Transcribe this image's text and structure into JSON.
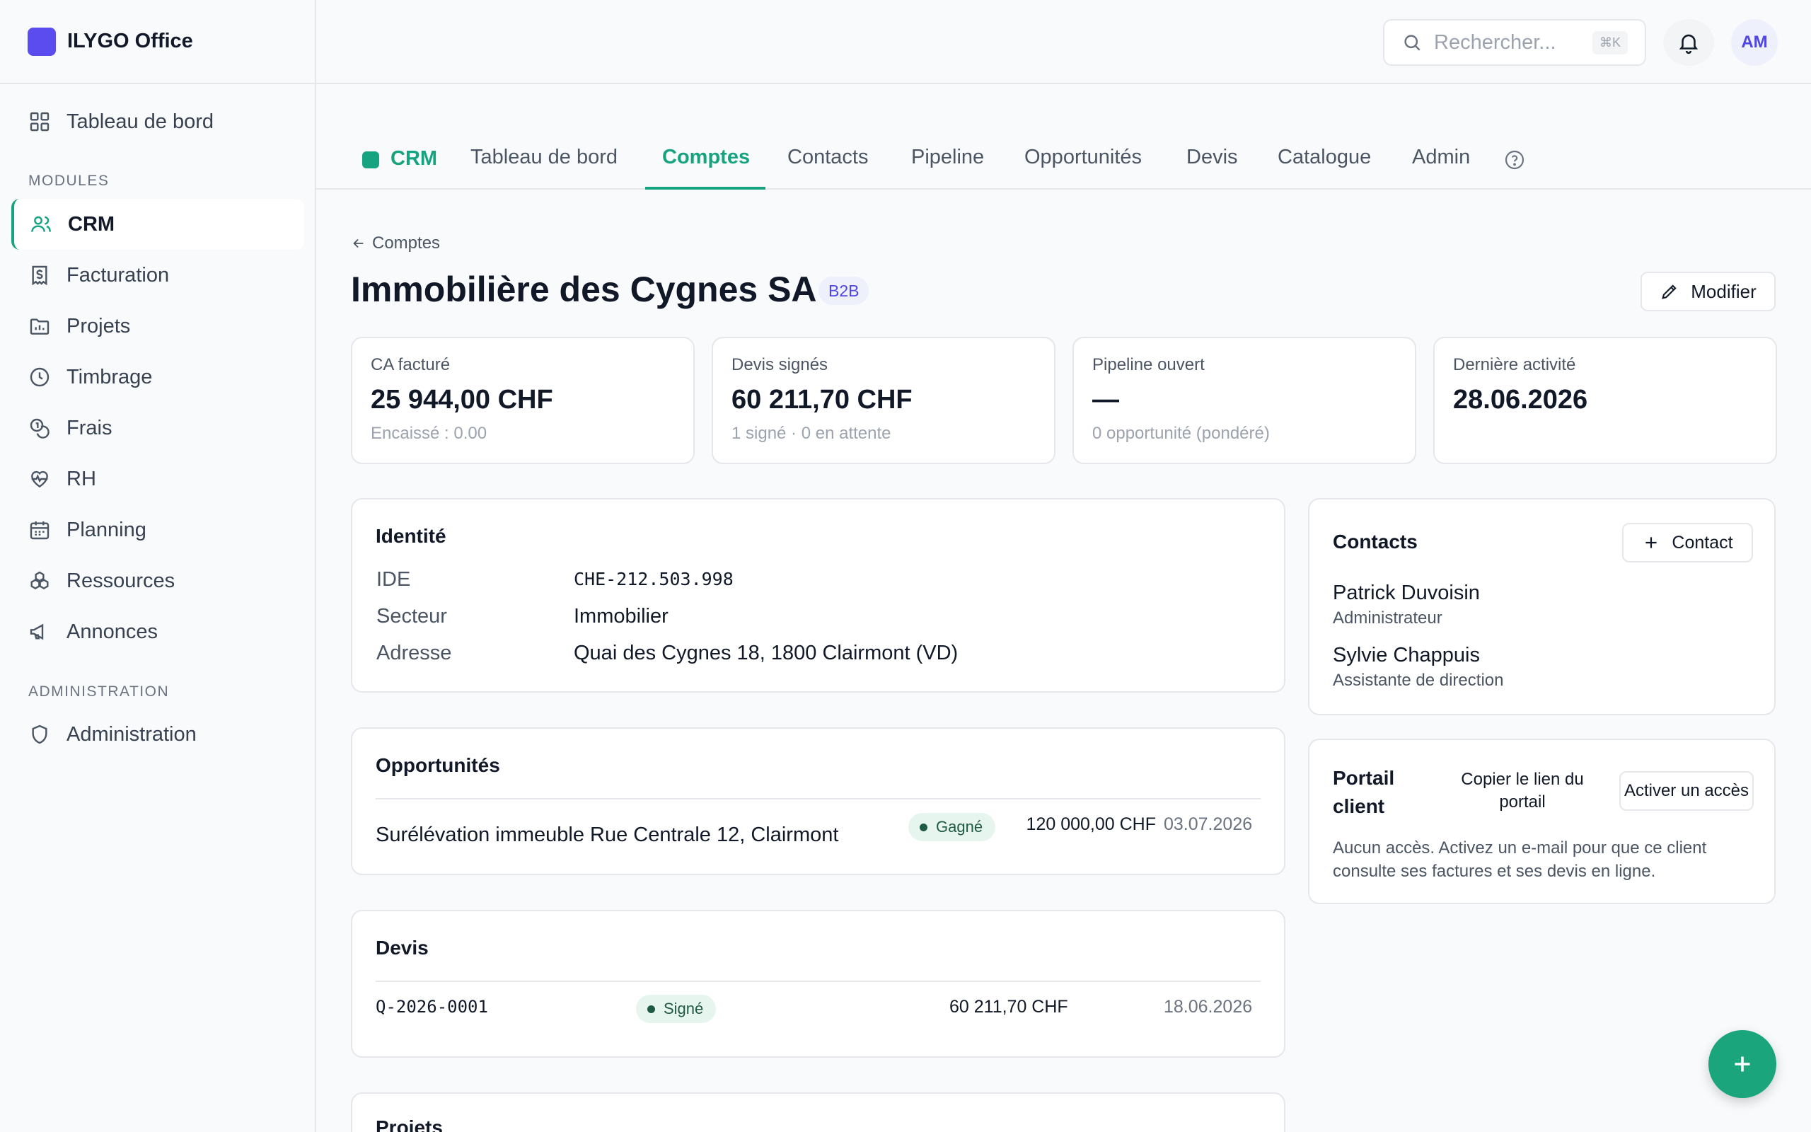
{
  "app": {
    "name": "ILYGO Office"
  },
  "sidebar": {
    "top_item": "Tableau de bord",
    "section_modules": "MODULES",
    "modules": [
      {
        "label": "CRM",
        "icon": "users-icon",
        "active": true
      },
      {
        "label": "Facturation",
        "icon": "invoice-icon"
      },
      {
        "label": "Projets",
        "icon": "folder-chart-icon"
      },
      {
        "label": "Timbrage",
        "icon": "clock-icon"
      },
      {
        "label": "Frais",
        "icon": "coins-icon"
      },
      {
        "label": "RH",
        "icon": "heart-pulse-icon"
      },
      {
        "label": "Planning",
        "icon": "calendar-icon"
      },
      {
        "label": "Ressources",
        "icon": "boxes-icon"
      },
      {
        "label": "Annonces",
        "icon": "megaphone-icon"
      }
    ],
    "section_admin": "ADMINISTRATION",
    "admin_item": "Administration"
  },
  "header": {
    "search_placeholder": "Rechercher...",
    "search_shortcut": "⌘K",
    "avatar_initials": "AM"
  },
  "module_tabs": {
    "module": "CRM",
    "tabs": [
      "Tableau de bord",
      "Comptes",
      "Contacts",
      "Pipeline",
      "Opportunités",
      "Devis",
      "Catalogue",
      "Admin"
    ],
    "active": "Comptes"
  },
  "page": {
    "breadcrumb": "Comptes",
    "title": "Immobilière des Cygnes SA",
    "tag": "B2B",
    "edit_label": "Modifier"
  },
  "stats": [
    {
      "label": "CA facturé",
      "value": "25 944,00 CHF",
      "sub": "Encaissé : 0.00"
    },
    {
      "label": "Devis signés",
      "value": "60 211,70 CHF",
      "sub": "1 signé · 0 en attente"
    },
    {
      "label": "Pipeline ouvert",
      "value": "—",
      "sub": "0 opportunité (pondéré)"
    },
    {
      "label": "Dernière activité",
      "value": "28.06.2026",
      "sub": ""
    }
  ],
  "identity": {
    "title": "Identité",
    "rows": [
      {
        "key": "IDE",
        "value": "CHE-212.503.998"
      },
      {
        "key": "Secteur",
        "value": "Immobilier"
      },
      {
        "key": "Adresse",
        "value": "Quai des Cygnes 18, 1800 Clairmont (VD)"
      }
    ]
  },
  "opportunities": {
    "title": "Opportunités",
    "rows": [
      {
        "name": "Surélévation immeuble Rue Centrale 12, Clairmont",
        "status": "Gagné",
        "amount": "120 000,00 CHF",
        "date": "03.07.2026"
      }
    ]
  },
  "quotes": {
    "title": "Devis",
    "rows": [
      {
        "number": "Q-2026-0001",
        "status": "Signé",
        "amount": "60 211,70 CHF",
        "date": "18.06.2026"
      }
    ]
  },
  "projects": {
    "title": "Projets"
  },
  "contacts": {
    "title": "Contacts",
    "add_label": "Contact",
    "people": [
      {
        "name": "Patrick Duvoisin",
        "role": "Administrateur"
      },
      {
        "name": "Sylvie Chappuis",
        "role": "Assistante de direction"
      }
    ]
  },
  "portal": {
    "title": "Portail client",
    "copy_link_label": "Copier le lien du portail",
    "activate_label": "Activer un accès",
    "note": "Aucun accès. Activez un e-mail pour que ce client consulte ses factures et ses devis en ligne."
  }
}
